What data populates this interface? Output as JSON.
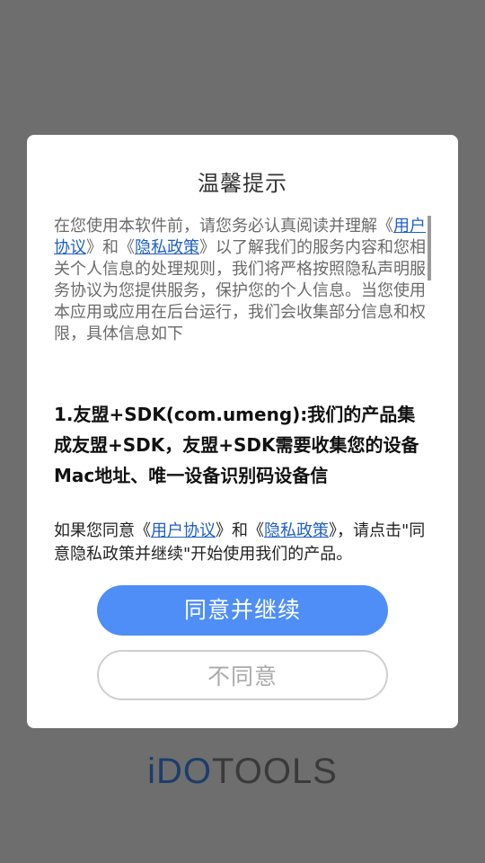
{
  "dialog": {
    "title": "温馨提示",
    "intro": {
      "prefix": "在您使用本软件前，请您务必认真阅读并理解《",
      "user_agreement": "用户协议",
      "middle": "》和《",
      "privacy_policy": "隐私政策",
      "suffix": "》以了解我们的服务内容和您相关个人信息的处理规则，我们将严格按照隐私声明服务协议为您提供服务，保护您的个人信息。当您使用本应用或应用在后台运行，我们会收集部分信息和权限，具体信息如下"
    },
    "section_1": "1.友盟+SDK(com.umeng):我们的产品集成友盟+SDK，友盟+SDK需要收集您的设备Mac地址、唯一设备识别码设备信",
    "consent": {
      "prefix": "如果您同意《",
      "user_agreement": "用户协议",
      "middle": "》和《",
      "privacy_policy": "隐私政策",
      "suffix": "》，请点击\"同意隐私政策并继续\"开始使用我们的产品。"
    },
    "agree_label": "同意并继续",
    "disagree_label": "不同意"
  },
  "brand": {
    "logo_accent": "iDO",
    "logo_rest": "TOOLS"
  },
  "colors": {
    "overlay": "#6e6e6e",
    "primary_button": "#4f8ef7",
    "link": "#1f5fc6"
  }
}
